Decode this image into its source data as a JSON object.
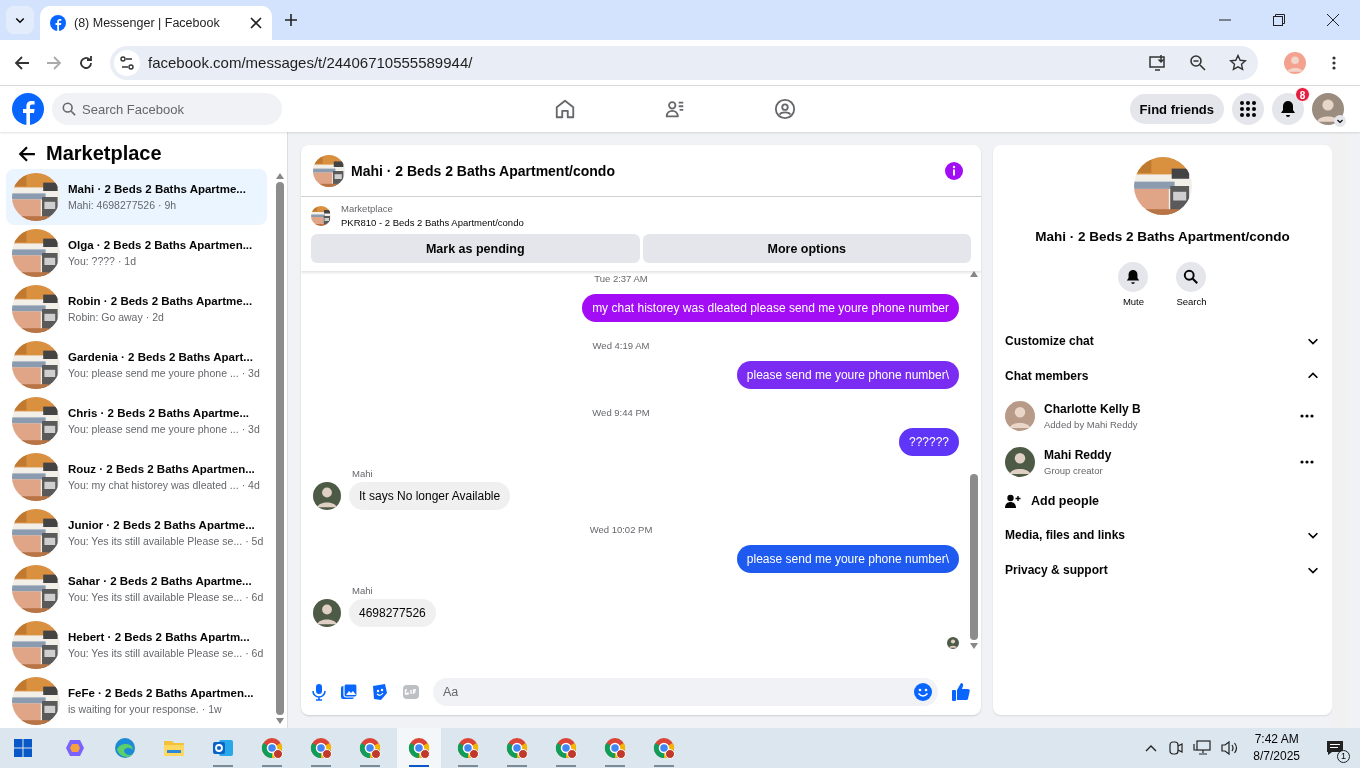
{
  "browser": {
    "tab_title": "(8) Messenger | Facebook",
    "url": "facebook.com/messages/t/24406710555589944/"
  },
  "topbar": {
    "search_placeholder": "Search Facebook",
    "find_friends": "Find friends",
    "notification_count": "8"
  },
  "sidebar": {
    "title": "Marketplace",
    "conversations": [
      {
        "title": "Mahi · 2 Beds 2 Baths Apartme...",
        "preview": "Mahi: 4698277526",
        "time": "· 9h",
        "selected": true
      },
      {
        "title": "Olga · 2 Beds 2 Baths Apartmen...",
        "preview": "You: ????",
        "time": "· 1d",
        "selected": false
      },
      {
        "title": "Robin · 2 Beds 2 Baths Apartme...",
        "preview": "Robin: Go away",
        "time": "· 2d",
        "selected": false
      },
      {
        "title": "Gardenia · 2 Beds 2 Baths Apart...",
        "preview": "You: please send me youre phone ...",
        "time": "· 3d",
        "selected": false
      },
      {
        "title": "Chris · 2 Beds 2 Baths Apartme...",
        "preview": "You: please send me youre phone ...",
        "time": "· 3d",
        "selected": false
      },
      {
        "title": "Rouz · 2 Beds 2 Baths Apartmen...",
        "preview": "You: my chat historey was dleated ...",
        "time": "· 4d",
        "selected": false
      },
      {
        "title": "Junior · 2 Beds 2 Baths Apartme...",
        "preview": "You: Yes its still available Please se...",
        "time": "· 5d",
        "selected": false
      },
      {
        "title": "Sahar · 2 Beds 2 Baths Apartme...",
        "preview": "You: Yes its still available Please se...",
        "time": "· 6d",
        "selected": false
      },
      {
        "title": "Hebert · 2 Beds 2 Baths Apartm...",
        "preview": "You: Yes its still available Please se...",
        "time": "· 6d",
        "selected": false
      },
      {
        "title": "FeFe · 2 Beds 2 Baths Apartmen...",
        "preview": "is waiting for your response.",
        "time": "· 1w",
        "selected": false
      }
    ]
  },
  "chat": {
    "title": "Mahi · 2 Beds 2 Baths Apartment/condo",
    "listing": {
      "label": "Marketplace",
      "name": "PKR810 - 2 Beds 2 Baths Apartment/condo"
    },
    "actions": [
      "Mark as pending",
      "More options"
    ],
    "messages": [
      {
        "kind": "time",
        "text": "Tue 2:37 AM"
      },
      {
        "kind": "sent",
        "text": "my chat historey  was dleated please send me youre phone number",
        "color": "#a20df5"
      },
      {
        "kind": "time",
        "text": "Wed 4:19 AM"
      },
      {
        "kind": "sent",
        "text": "please send me youre phone number\\",
        "color": "#7b2cf2"
      },
      {
        "kind": "time",
        "text": "Wed 9:44 PM"
      },
      {
        "kind": "sent",
        "text": "??????",
        "color": "#5f35f7"
      },
      {
        "kind": "received",
        "sender": "Mahi",
        "text": "It says No longer Available"
      },
      {
        "kind": "time",
        "text": "Wed 10:02 PM"
      },
      {
        "kind": "sent",
        "text": "please send me youre phone number\\",
        "color": "#1f5af0"
      },
      {
        "kind": "received",
        "sender": "Mahi",
        "text": "4698277526"
      }
    ],
    "composer_placeholder": "Aa"
  },
  "info": {
    "title": "Mahi · 2 Beds 2 Baths Apartment/condo",
    "actions": [
      {
        "kind": "mute",
        "label": "Mute"
      },
      {
        "kind": "search",
        "label": "Search"
      }
    ],
    "sections": [
      {
        "label": "Customize chat",
        "expanded": false
      },
      {
        "label": "Chat members",
        "expanded": true,
        "members": [
          {
            "name": "Charlotte Kelly B",
            "role": "Added by Mahi Reddy"
          },
          {
            "name": "Mahi Reddy",
            "role": "Group creator"
          }
        ],
        "add_label": "Add people"
      },
      {
        "label": "Media, files and links",
        "expanded": false
      },
      {
        "label": "Privacy & support",
        "expanded": false
      }
    ]
  },
  "taskbar": {
    "apps": [
      {
        "kind": "copilot",
        "selected": false
      },
      {
        "kind": "edge",
        "selected": false
      },
      {
        "kind": "explorer",
        "selected": false
      },
      {
        "kind": "outlook",
        "selected": false
      },
      {
        "kind": "chrome",
        "selected": false
      },
      {
        "kind": "chrome",
        "selected": false
      },
      {
        "kind": "chrome",
        "selected": false
      },
      {
        "kind": "chrome",
        "selected": true
      },
      {
        "kind": "chrome",
        "selected": false
      },
      {
        "kind": "chrome",
        "selected": false
      },
      {
        "kind": "chrome",
        "selected": false
      },
      {
        "kind": "chrome",
        "selected": false
      },
      {
        "kind": "chrome",
        "selected": false
      }
    ],
    "time": "7:42 AM",
    "date": "8/7/2025",
    "notification_count": "1"
  }
}
